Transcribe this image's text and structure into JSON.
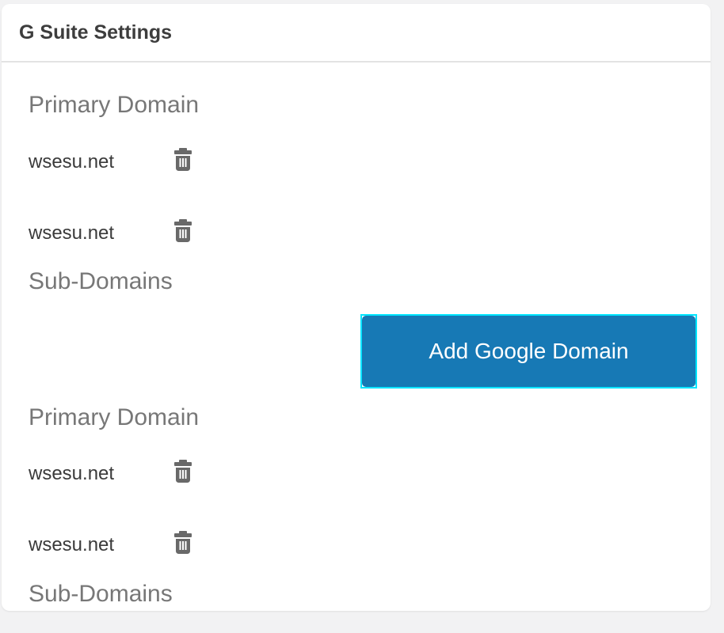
{
  "panel": {
    "title": "G Suite Settings",
    "sections": [
      {
        "primary_heading": "Primary Domain",
        "primary_domains": [
          "wsesu.net",
          "wsesu.net"
        ],
        "sub_heading": "Sub-Domains"
      },
      {
        "primary_heading": "Primary Domain",
        "primary_domains": [
          "wsesu.net",
          "wsesu.net"
        ],
        "sub_heading": "Sub-Domains"
      }
    ],
    "add_button": {
      "label": "Add Google Domain"
    }
  },
  "icons": {
    "delete": "trash-icon"
  },
  "colors": {
    "accent_blue": "#1779b5",
    "focus_highlight": "#00e5ff",
    "heading_gray": "#777777",
    "text_dark": "#3a3a3a",
    "icon_gray": "#696969",
    "page_background": "#f2f2f3",
    "panel_background": "#ffffff"
  }
}
